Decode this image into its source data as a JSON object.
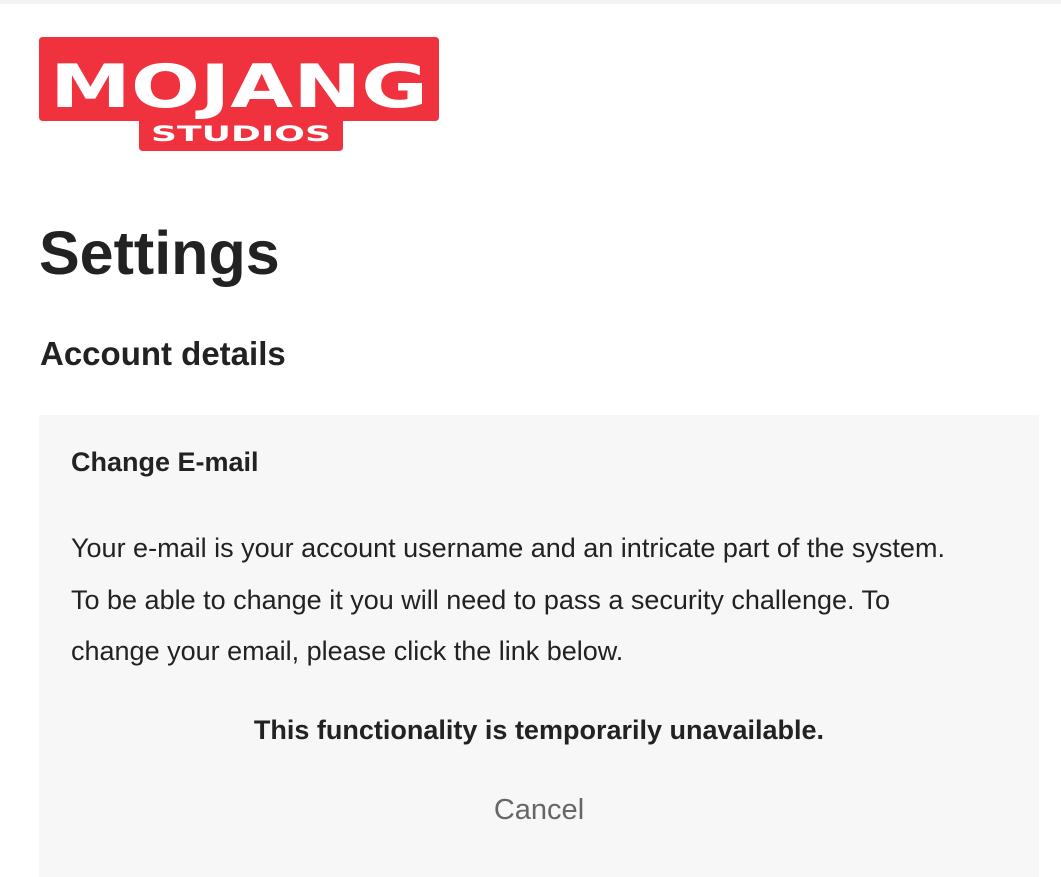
{
  "brand": {
    "name": "MOJANG",
    "subtitle": "STUDIOS",
    "color": "#ef323d"
  },
  "page": {
    "title": "Settings",
    "section_title": "Account details"
  },
  "change_email": {
    "title": "Change E-mail",
    "description": "Your e-mail is your account username and an intricate part of the system. To be able to change it you will need to pass a security challenge. To change your email, please click the link below.",
    "notice": "This functionality is temporarily unavailable.",
    "cancel_label": "Cancel"
  },
  "colors": {
    "card_background": "#f7f7f7",
    "text": "#222222",
    "muted_text": "#666666"
  }
}
